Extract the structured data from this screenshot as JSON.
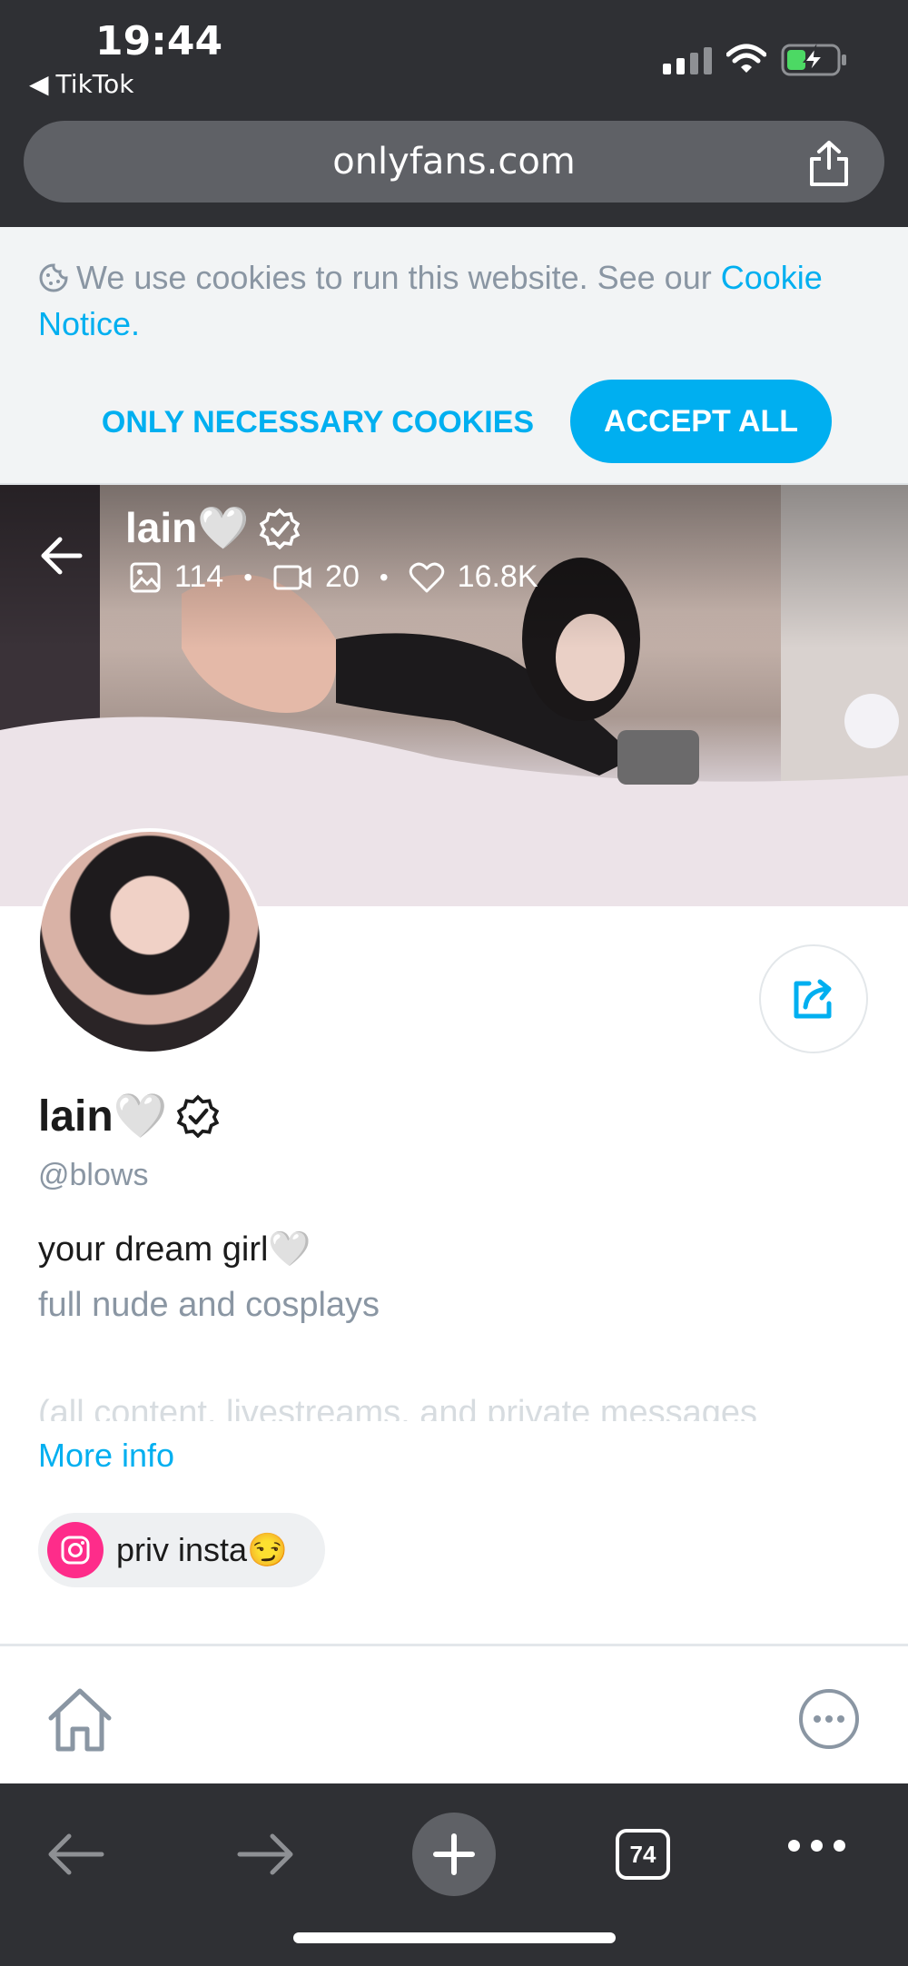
{
  "status_bar": {
    "time": "19:44",
    "back_app": "TikTok"
  },
  "browser": {
    "url": "onlyfans.com",
    "tabs_count": "74"
  },
  "cookie_banner": {
    "text": "We use cookies to run this website. See our ",
    "link": "Cookie Notice",
    "text_end": ".",
    "btn_necessary": "ONLY NECESSARY COOKIES",
    "btn_accept": "ACCEPT ALL"
  },
  "cover": {
    "name": "lain🤍",
    "stats": {
      "photos": "114",
      "videos": "20",
      "likes": "16.8K"
    }
  },
  "profile": {
    "name": "lain🤍",
    "handle": "@blows",
    "bio_line1": "your dream girl🤍",
    "bio_line2": "full nude and cosplays",
    "bio_line3": "(all content, livestreams, and private messages",
    "more_info": "More info",
    "social_link": "priv insta😏"
  },
  "colors": {
    "accent": "#00aff0",
    "chrome": "#2f3034",
    "instagram": "#fe2c8a"
  }
}
